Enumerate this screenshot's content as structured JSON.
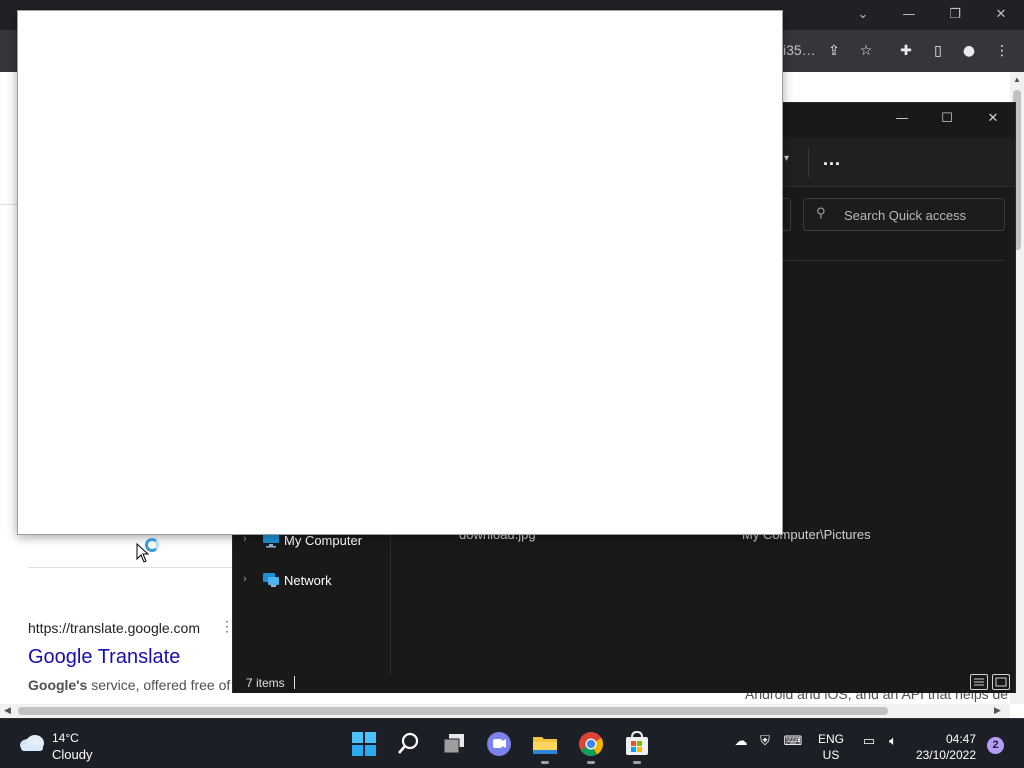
{
  "chrome": {
    "url_fragment": "i35…",
    "icons": [
      "chevron-down-icon",
      "minimize-icon",
      "restore-icon",
      "close-icon",
      "share-icon",
      "star-icon",
      "extensions-icon",
      "side-panel-icon",
      "profile-icon",
      "menu-icon"
    ]
  },
  "search_result": {
    "url": "https://translate.google.com",
    "title": "Google Translate",
    "snippet_bold": "Google's",
    "snippet_text": " service, offered free of c",
    "right_snippet": "Android and iOS, and an API that helps de"
  },
  "explorer": {
    "search_placeholder": "Search Quick access",
    "more_label": "...",
    "nav": {
      "my_computer": "My Computer",
      "network": "Network"
    },
    "file": {
      "name": "download.jpg",
      "location": "My Computer\\Pictures"
    },
    "status": {
      "item_count": "7 items"
    }
  },
  "taskbar": {
    "weather": {
      "temp": "14°C",
      "condition": "Cloudy"
    },
    "apps": [
      "start",
      "search",
      "task-view",
      "teams-chat",
      "file-explorer",
      "chrome",
      "microsoft-store"
    ],
    "lang_top": "ENG",
    "lang_bottom": "US",
    "time": "04:47",
    "date": "23/10/2022",
    "notification_count": "2"
  },
  "colors": {
    "link_blue": "#1a0dab",
    "explorer_bg": "#191919",
    "taskbar_bg": "#1c2026",
    "chrome_toolbar": "#35363a"
  }
}
